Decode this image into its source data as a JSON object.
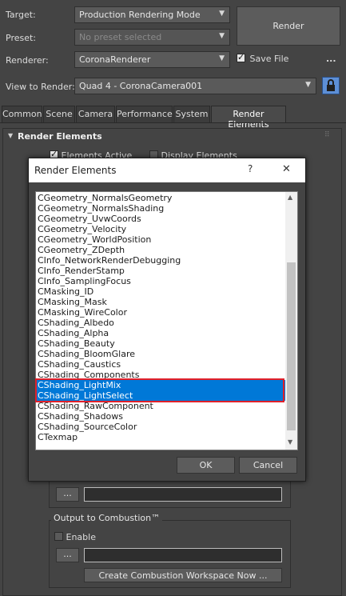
{
  "main": {
    "target_label": "Target:",
    "target_value": "Production Rendering Mode",
    "preset_label": "Preset:",
    "preset_value": "No preset selected",
    "renderer_label": "Renderer:",
    "renderer_value": "CoronaRenderer",
    "save_file_label": "Save File",
    "more_label": "...",
    "render_button": "Render",
    "view_label": "View to Render:",
    "view_value": "Quad 4 - CoronaCamera001",
    "dropdown_arrow": "▼"
  },
  "tabs": [
    {
      "label": "Common"
    },
    {
      "label": "Scene"
    },
    {
      "label": "Camera"
    },
    {
      "label": "Performance"
    },
    {
      "label": "System"
    },
    {
      "label": "Render Elements"
    }
  ],
  "rollout": {
    "title": "Render Elements",
    "collapse_glyph": "▼",
    "elements_active": "Elements Active",
    "display_elements": "Display Elements"
  },
  "lower": {
    "browse_label": "...",
    "combustion_title": "Output to Combustion™",
    "enable_label": "Enable",
    "workspace_button": "Create Combustion Workspace Now ..."
  },
  "dialog": {
    "title": "Render Elements",
    "help_glyph": "?",
    "close_glyph": "✕",
    "ok_label": "OK",
    "cancel_label": "Cancel",
    "items": [
      "CGeometry_NormalsGeometry",
      "CGeometry_NormalsShading",
      "CGeometry_UvwCoords",
      "CGeometry_Velocity",
      "CGeometry_WorldPosition",
      "CGeometry_ZDepth",
      "CInfo_NetworkRenderDebugging",
      "CInfo_RenderStamp",
      "CInfo_SamplingFocus",
      "CMasking_ID",
      "CMasking_Mask",
      "CMasking_WireColor",
      "CShading_Albedo",
      "CShading_Alpha",
      "CShading_Beauty",
      "CShading_BloomGlare",
      "CShading_Caustics",
      "CShading_Components",
      "CShading_LightMix",
      "CShading_LightSelect",
      "CShading_RawComponent",
      "CShading_Shadows",
      "CShading_SourceColor",
      "CTexmap"
    ],
    "selected": [
      "CShading_LightMix",
      "CShading_LightSelect"
    ],
    "highlight_color": "#e0202a",
    "selection_color": "#0078d7"
  }
}
